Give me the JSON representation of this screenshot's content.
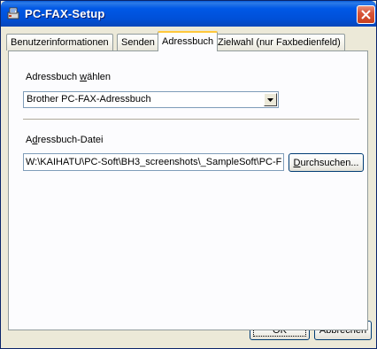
{
  "window": {
    "title": "PC-FAX-Setup"
  },
  "tabs": [
    {
      "label": "Benutzerinformationen"
    },
    {
      "label": "Senden"
    },
    {
      "label": "Adressbuch"
    },
    {
      "label": "Zielwahl (nur Faxbedienfeld)"
    }
  ],
  "addressbook": {
    "select_label_pre": "Adressbuch ",
    "select_label_mnemonic": "w",
    "select_label_post": "ählen",
    "selected_value": "Brother PC-FAX-Adressbuch",
    "file_label_pre": "A",
    "file_label_mnemonic": "d",
    "file_label_post": "ressbuch-Datei",
    "file_path": "W:\\KAIHATU\\PC-Soft\\BH3_screenshots\\_SampleSoft\\PC-F",
    "browse_mnemonic": "D",
    "browse_label_post": "urchsuchen..."
  },
  "footer": {
    "ok_label": "OK",
    "cancel_label": "Abbrechen"
  },
  "colors": {
    "titlebar": "#0058e6",
    "close_button": "#d8553a",
    "active_tab_accent": "#ffc83c",
    "window_bg": "#ece9d8"
  }
}
